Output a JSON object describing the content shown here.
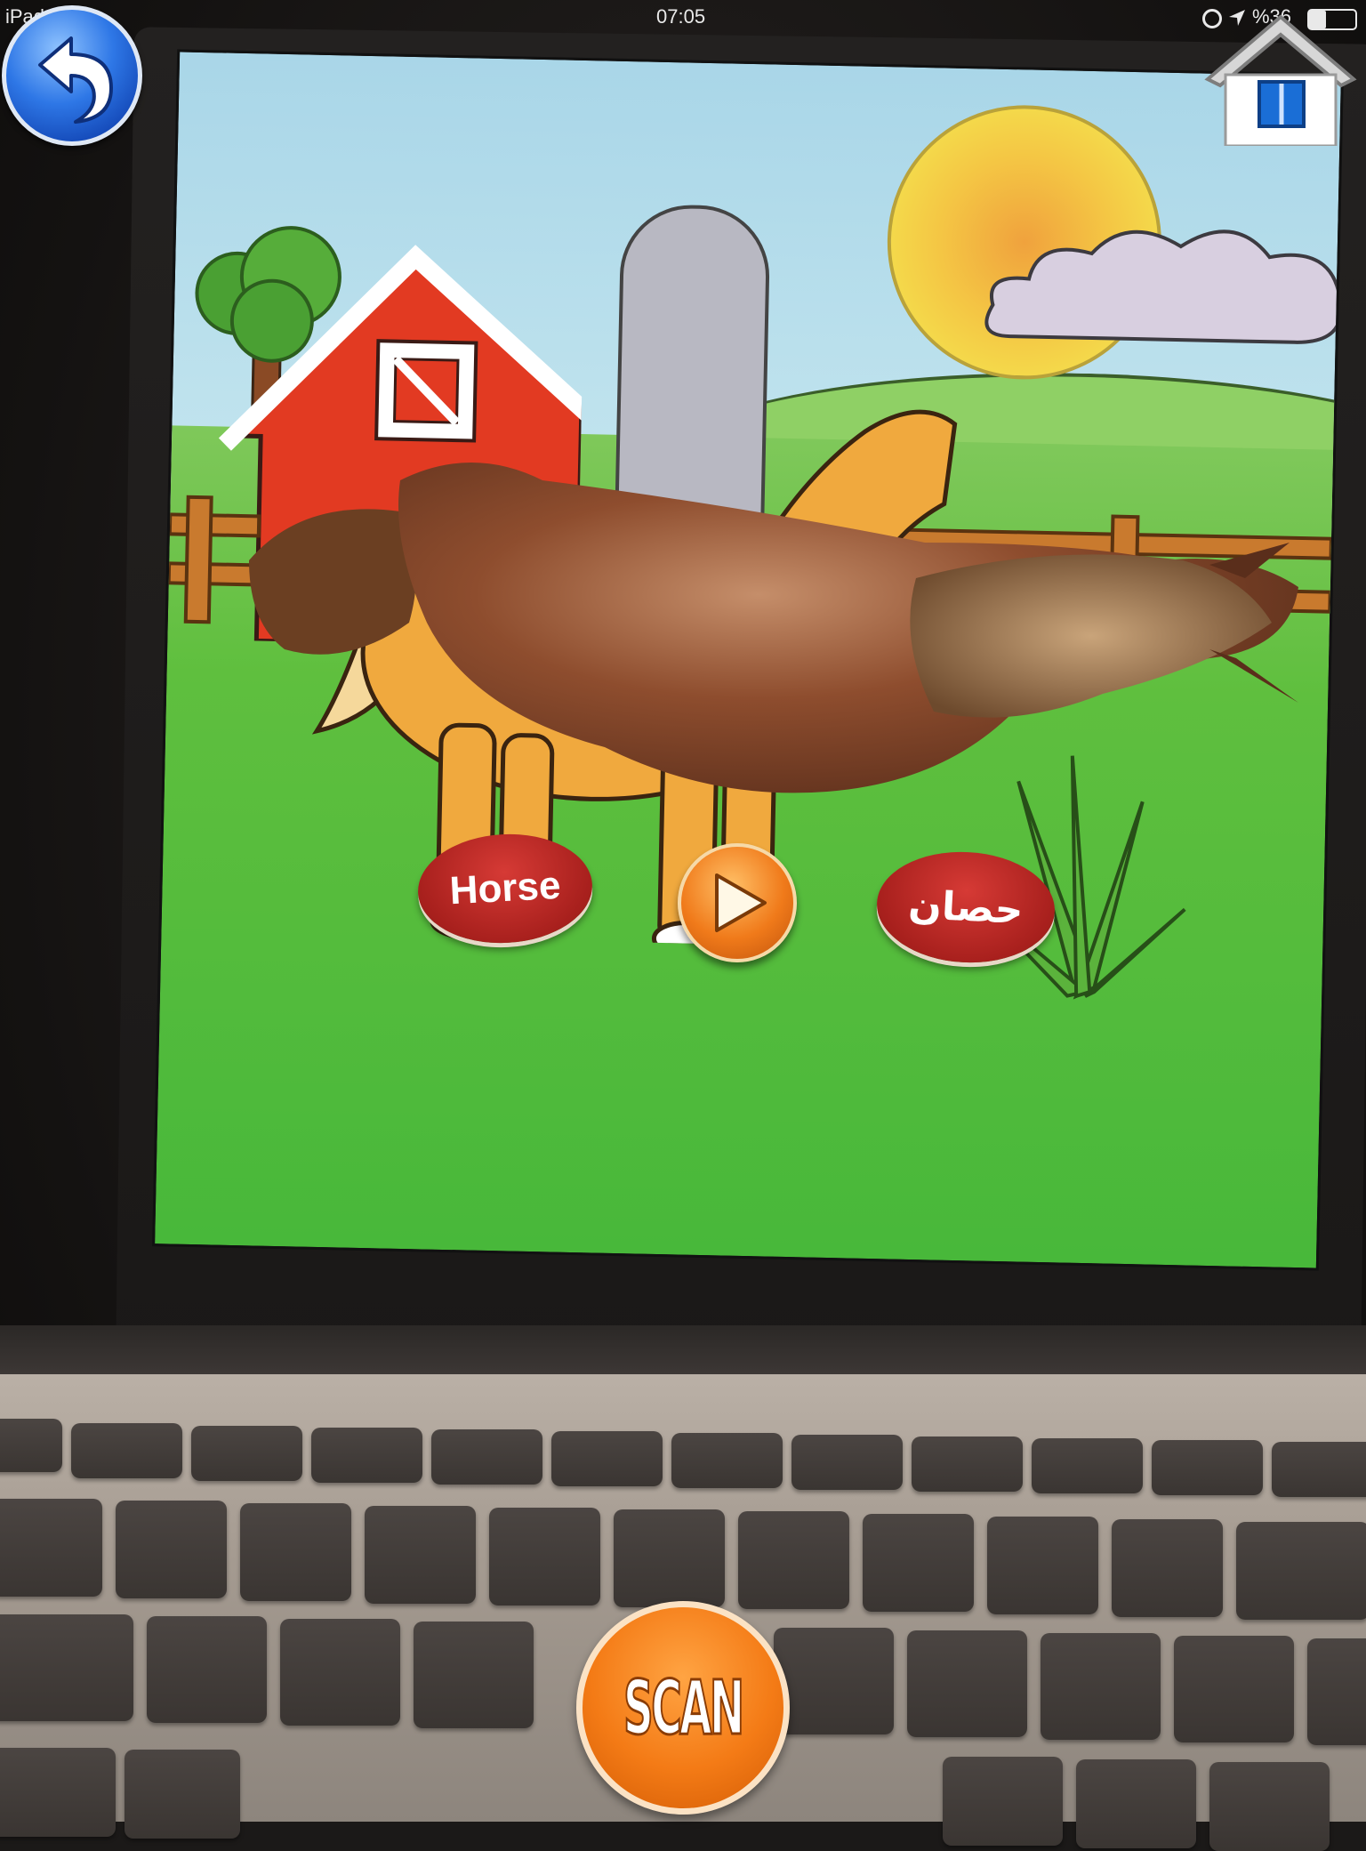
{
  "status_bar": {
    "carrier": "iPad",
    "time": "07:05",
    "battery": "%36"
  },
  "top_bar": {
    "back_icon": "back-arrow-icon",
    "home_icon": "home-icon"
  },
  "ar_overlay": {
    "english_label": "Horse",
    "arabic_label": "حصان",
    "play_icon": "play-icon"
  },
  "scan_button": {
    "label": "SCAN"
  },
  "colors": {
    "back_button": "#1e5fd6",
    "label_red": "#b3221f",
    "play_orange": "#f07a1a",
    "scan_orange": "#f47b16"
  }
}
